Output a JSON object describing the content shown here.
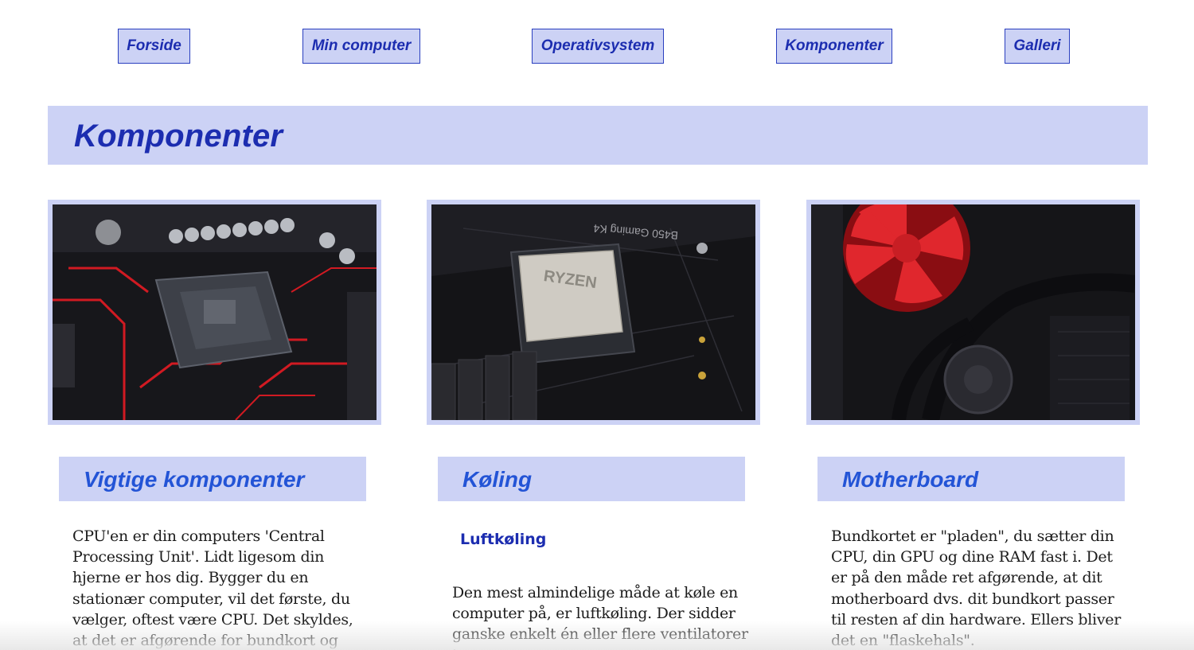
{
  "nav": {
    "items": [
      {
        "label": "Forside"
      },
      {
        "label": "Min computer"
      },
      {
        "label": "Operativsystem"
      },
      {
        "label": "Komponenter"
      },
      {
        "label": "Galleri"
      }
    ]
  },
  "page": {
    "title": "Komponenter"
  },
  "images": [
    {
      "icon": "cpu-socket-photo"
    },
    {
      "icon": "ryzen-cpu-photo"
    },
    {
      "icon": "red-fan-cooler-photo"
    }
  ],
  "sections": [
    {
      "title": "Vigtige komponenter",
      "body": "CPU'en er din computers 'Central Processing Unit'. Lidt ligesom din hjerne er hos dig. Bygger du en stationær computer, vil det første, du vælger, oftest være CPU. Det skyldes, at det er afgørende for bundkort og RAM"
    },
    {
      "title": "Køling",
      "subheading": "Luftkøling",
      "body": "Den mest almindelige måde at køle en computer på, er luftkøling. Der sidder ganske enkelt én eller flere ventilatorer i"
    },
    {
      "title": "Motherboard",
      "body": "Bundkortet er \"pladen\", du sætter din CPU, din GPU og dine RAM fast i. Det er på den måde ret afgørende, at dit motherboard dvs. dit bundkort passer til resten af din hardware. Ellers bliver det en \"flaskehals\"."
    }
  ],
  "colors": {
    "accent": "#1c2db0",
    "panel": "#ccd2f5",
    "section_title": "#2354d6"
  }
}
